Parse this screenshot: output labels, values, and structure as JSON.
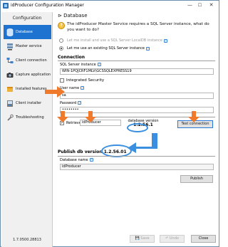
{
  "window": {
    "title": "idProducer Configuration Manager",
    "min": "—",
    "max": "☐",
    "close": "✕"
  },
  "sidebar": {
    "title": "Configuration",
    "items": [
      {
        "label": "Database",
        "icon": "database-icon",
        "active": true
      },
      {
        "label": "Master service",
        "icon": "server-icon"
      },
      {
        "label": "Client connection",
        "icon": "network-icon"
      },
      {
        "label": "Capture application",
        "icon": "camera-icon"
      },
      {
        "label": "Installed features",
        "icon": "puzzle-icon"
      },
      {
        "label": "Client installer",
        "icon": "installer-icon"
      },
      {
        "label": "Troubleshooting",
        "icon": "wrench-icon"
      }
    ],
    "version": "1.7.0500.28813"
  },
  "content": {
    "heading_arrow": "⊳",
    "heading": "Database",
    "intro": "The idProducer Master Service requires a SQL Server instance, what do you want to do?",
    "radio_install": "Let me install and use a SQL Server LocalDB instance",
    "radio_existing": "Let me use an existing SQL Server instance",
    "connection_section": "Connection",
    "sql_instance_label": "SQL Server instance",
    "sql_instance_value": "WIN-1PQJCRF1MLV\\GCSSQLEXPRESS19",
    "integrated_security": "Integrated Security",
    "username_label": "User name",
    "username_value": "sa",
    "password_label": "Password",
    "password_value": "••••••••",
    "retrieve_label": "Retrieve",
    "retrieve_value": "idProducer",
    "db_version_label": "database version",
    "db_version_value": "1.2.56.1",
    "test_button": "Test connection",
    "publish_section": "Publish db version",
    "publish_version": "1.2.56.01",
    "dbname_label": "Database name",
    "dbname_value": "idProducer",
    "publish_button": "Publish"
  },
  "footer": {
    "save": "Save",
    "undo": "Undo",
    "close": "Close"
  },
  "colors": {
    "accent": "#1e73d1",
    "arrow": "#f07a2c",
    "callout": "#3a8fe0"
  }
}
